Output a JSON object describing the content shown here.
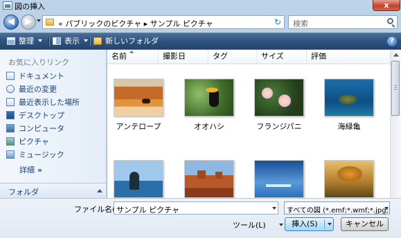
{
  "window": {
    "title": "図の挿入",
    "close_label": "x"
  },
  "nav": {
    "back_label": "◀",
    "forward_label": "▶",
    "address_text": "« パブリックのピクチャ ▸ サンプル ピクチャ",
    "refresh_glyph": "↻",
    "search_placeholder": "検索"
  },
  "toolbar": {
    "organize_label": "整理",
    "view_label": "表示",
    "new_folder_label": "新しいフォルダ",
    "help_label": "?"
  },
  "sidebar": {
    "favorites_title": "お気に入りリンク",
    "items": [
      {
        "label": "ドキュメント",
        "icon": "documents-icon"
      },
      {
        "label": "最近の変更",
        "icon": "recent-changes-icon"
      },
      {
        "label": "最近表示した場所",
        "icon": "recent-places-icon"
      },
      {
        "label": "デスクトップ",
        "icon": "desktop-icon"
      },
      {
        "label": "コンピュータ",
        "icon": "computer-icon"
      },
      {
        "label": "ピクチャ",
        "icon": "pictures-icon"
      },
      {
        "label": "ミュージック",
        "icon": "music-icon"
      }
    ],
    "details_label": "詳細",
    "details_glyph": "»",
    "folders_label": "フォルダ"
  },
  "columns": [
    "名前",
    "撮影日",
    "タグ",
    "サイズ",
    "評価"
  ],
  "files": [
    {
      "name": "アンテロープ"
    },
    {
      "name": "オオハシ"
    },
    {
      "name": "フランジパニ"
    },
    {
      "name": "海緑亀"
    },
    {
      "name": ""
    },
    {
      "name": ""
    },
    {
      "name": ""
    },
    {
      "name": ""
    }
  ],
  "bottom": {
    "filename_label": "ファイル名(N):",
    "filename_value": "サンプル ピクチャ",
    "filter_value": "すべての図 (*.emf;*.wmf;*.jpg;*.jpe",
    "tools_label": "ツール(L)",
    "open_label": "挿入(S)",
    "cancel_label": "キャンセル"
  }
}
